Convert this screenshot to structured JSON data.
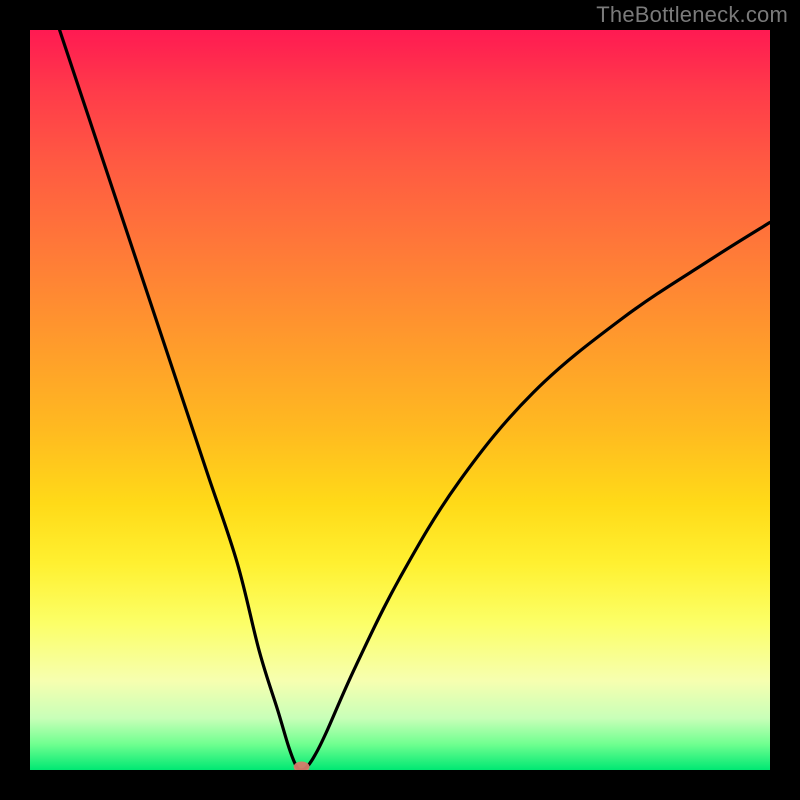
{
  "attribution": "TheBottleneck.com",
  "chart_data": {
    "type": "line",
    "title": "",
    "xlabel": "",
    "ylabel": "",
    "xlim": [
      0,
      100
    ],
    "ylim": [
      0,
      100
    ],
    "grid": false,
    "legend": false,
    "series": [
      {
        "name": "bottleneck-curve",
        "x": [
          4,
          8,
          12,
          16,
          20,
          24,
          28,
          31,
          33.5,
          35,
          36,
          36.7,
          37.5,
          38.5,
          40,
          44,
          50,
          58,
          68,
          80,
          92,
          100
        ],
        "values": [
          100,
          88,
          76,
          64,
          52,
          40,
          28,
          16,
          8,
          3,
          0.5,
          0,
          0.5,
          2,
          5,
          14,
          26,
          39,
          51,
          61,
          69,
          74
        ]
      }
    ],
    "optimal_point": {
      "x": 36.7,
      "y": 0
    },
    "background_gradient": {
      "stops": [
        {
          "pos": 0.0,
          "color": "#ff1a52"
        },
        {
          "pos": 0.5,
          "color": "#ffba20"
        },
        {
          "pos": 0.8,
          "color": "#fcff66"
        },
        {
          "pos": 1.0,
          "color": "#00e873"
        }
      ],
      "meaning": "top=high bottleneck, bottom=low bottleneck"
    }
  }
}
